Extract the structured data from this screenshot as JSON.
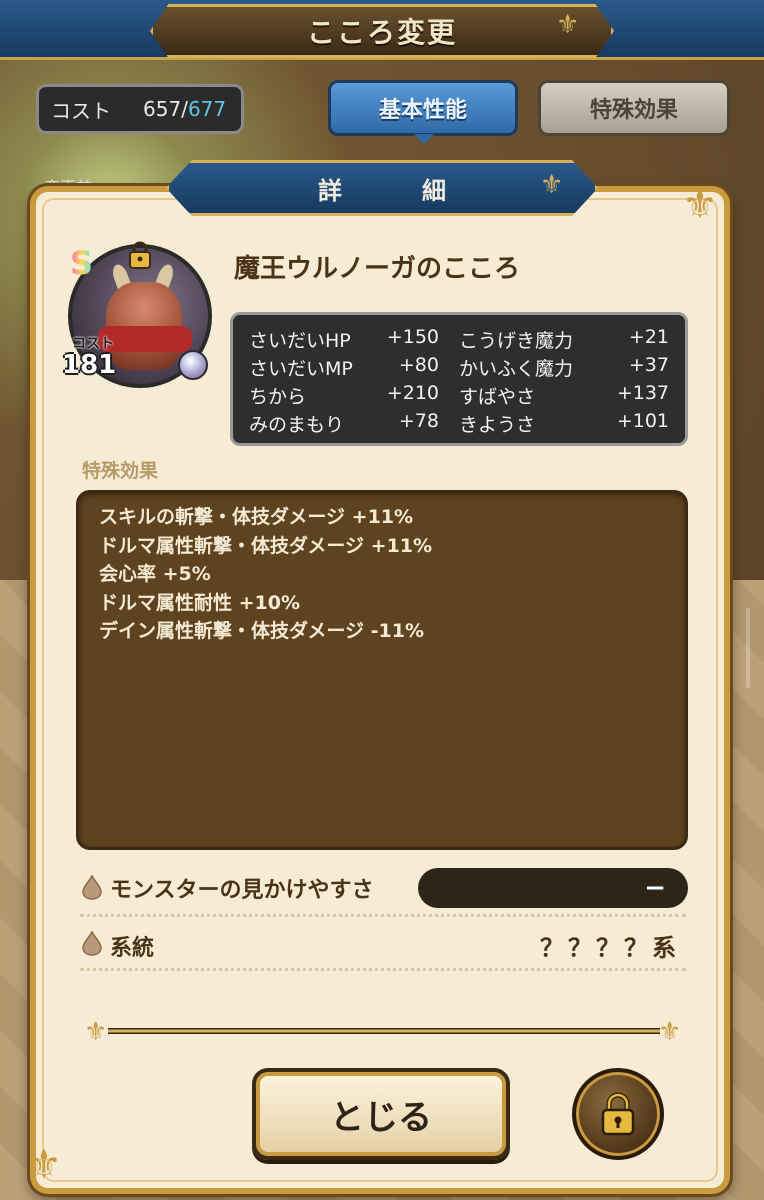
{
  "header": {
    "title": "こころ変更"
  },
  "cost": {
    "label": "コスト",
    "current": "657",
    "slash": "/",
    "max": "677"
  },
  "tabs": [
    {
      "label": "基本性能",
      "active": true
    },
    {
      "label": "特殊効果",
      "active": false
    }
  ],
  "behind": {
    "partial_label": "変更前"
  },
  "dialog": {
    "title": "詳　細",
    "monster": {
      "rank": "S",
      "name": "魔王ウルノーガのこころ",
      "cost_label": "コスト",
      "cost_value": "181"
    },
    "stats": [
      {
        "name": "さいだいHP",
        "value": "+150"
      },
      {
        "name": "こうげき魔力",
        "value": "+21"
      },
      {
        "name": "さいだいMP",
        "value": "+80"
      },
      {
        "name": "かいふく魔力",
        "value": "+37"
      },
      {
        "name": "ちから",
        "value": "+210"
      },
      {
        "name": "すばやさ",
        "value": "+137"
      },
      {
        "name": "みのまもり",
        "value": "+78"
      },
      {
        "name": "きようさ",
        "value": "+101"
      }
    ],
    "special_title": "特殊効果",
    "effects": [
      "スキルの斬撃・体技ダメージ +11%",
      "ドルマ属性斬撃・体技ダメージ +11%",
      "会心率 +5%",
      "ドルマ属性耐性 +10%",
      "デイン属性斬撃・体技ダメージ -11%"
    ],
    "visibility": {
      "label": "モンスターの見かけやすさ",
      "value": "−"
    },
    "lineage": {
      "label": "系統",
      "value": "？？？？系"
    },
    "close_label": "とじる"
  },
  "colors": {
    "accent_gold": "#c99a3e",
    "header_blue": "#2a5a8a",
    "cost_max_cyan": "#5fc6e6",
    "effects_bg": "#5e4320"
  },
  "icons": {
    "lock": "lock-icon",
    "orb": "orb-icon",
    "drop": "drop-icon"
  }
}
